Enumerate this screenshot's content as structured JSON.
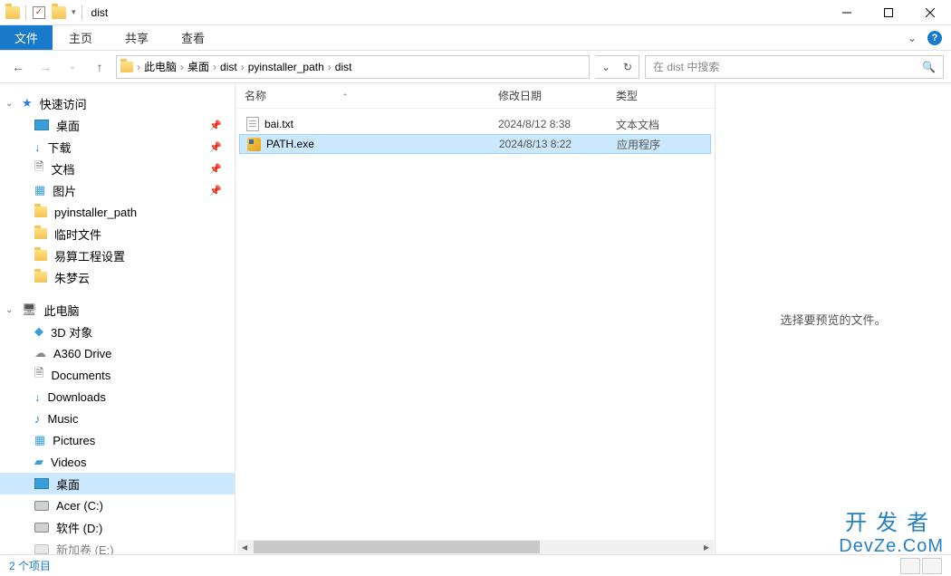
{
  "window": {
    "title": "dist"
  },
  "ribbon": {
    "file": "文件",
    "tabs": [
      "主页",
      "共享",
      "查看"
    ]
  },
  "breadcrumbs": [
    "此电脑",
    "桌面",
    "dist",
    "pyinstaller_path",
    "dist"
  ],
  "search": {
    "placeholder": "在 dist 中搜索"
  },
  "sidebar": {
    "quick_access": "快速访问",
    "quick_items": [
      {
        "label": "桌面",
        "pinned": true,
        "icon": "monitor"
      },
      {
        "label": "下载",
        "pinned": true,
        "icon": "download"
      },
      {
        "label": "文档",
        "pinned": true,
        "icon": "document"
      },
      {
        "label": "图片",
        "pinned": true,
        "icon": "picture"
      },
      {
        "label": "pyinstaller_path",
        "pinned": false,
        "icon": "folder"
      },
      {
        "label": "临时文件",
        "pinned": false,
        "icon": "folder"
      },
      {
        "label": "易算工程设置",
        "pinned": false,
        "icon": "folder"
      },
      {
        "label": "朱梦云",
        "pinned": false,
        "icon": "folder"
      }
    ],
    "this_pc": "此电脑",
    "pc_items": [
      {
        "label": "3D 对象",
        "icon": "3d"
      },
      {
        "label": "A360 Drive",
        "icon": "cloud"
      },
      {
        "label": "Documents",
        "icon": "document"
      },
      {
        "label": "Downloads",
        "icon": "download"
      },
      {
        "label": "Music",
        "icon": "music"
      },
      {
        "label": "Pictures",
        "icon": "picture"
      },
      {
        "label": "Videos",
        "icon": "video"
      },
      {
        "label": "桌面",
        "icon": "monitor",
        "selected": true
      },
      {
        "label": "Acer (C:)",
        "icon": "disk"
      },
      {
        "label": "软件 (D:)",
        "icon": "disk"
      },
      {
        "label": "新加卷 (E:)",
        "icon": "disk",
        "truncated": true
      }
    ]
  },
  "columns": {
    "name": "名称",
    "date": "修改日期",
    "type": "类型"
  },
  "files": [
    {
      "name": "bai.txt",
      "date": "2024/8/12 8:38",
      "type": "文本文档",
      "icon": "txt",
      "selected": false
    },
    {
      "name": "PATH.exe",
      "date": "2024/8/13 8:22",
      "type": "应用程序",
      "icon": "exe",
      "selected": true
    }
  ],
  "preview": {
    "message": "选择要预览的文件。"
  },
  "statusbar": {
    "count": "2 个项目"
  },
  "watermark": {
    "line1": "开发者",
    "line2": "DevZe.CoM"
  }
}
